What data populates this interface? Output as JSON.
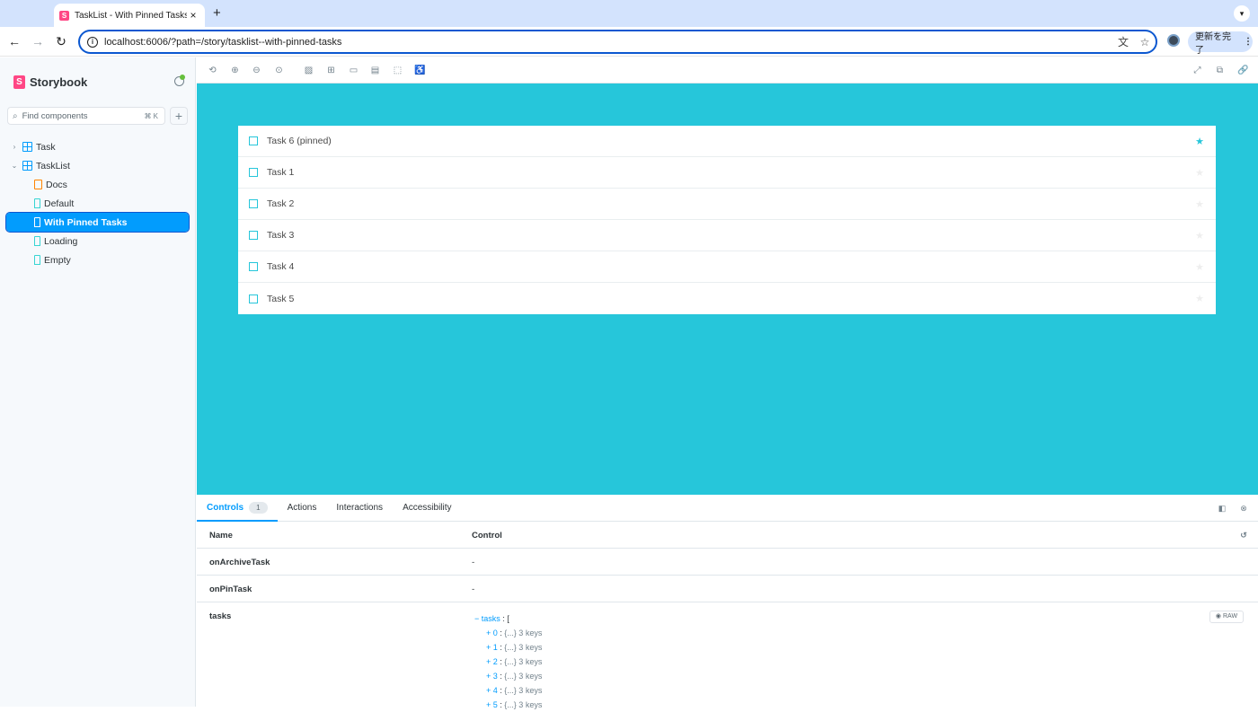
{
  "browser": {
    "tab_title": "TaskList - With Pinned Tasks",
    "tab_close": "×",
    "new_tab": "+",
    "url": "localhost:6006/?path=/story/tasklist--with-pinned-tasks",
    "update_label": "更新を完了"
  },
  "sidebar": {
    "brand": "Storybook",
    "search_placeholder": "Find components",
    "search_shortcut": "⌘ K",
    "tree": [
      {
        "label": "Task",
        "type": "component",
        "expanded": false
      },
      {
        "label": "TaskList",
        "type": "component",
        "expanded": true
      },
      {
        "label": "Docs",
        "type": "docs"
      },
      {
        "label": "Default",
        "type": "story"
      },
      {
        "label": "With Pinned Tasks",
        "type": "story",
        "selected": true
      },
      {
        "label": "Loading",
        "type": "story"
      },
      {
        "label": "Empty",
        "type": "story"
      }
    ]
  },
  "preview": {
    "background": "#26c6da",
    "tasks": [
      {
        "title": "Task 6 (pinned)",
        "pinned": true
      },
      {
        "title": "Task 1",
        "pinned": false
      },
      {
        "title": "Task 2",
        "pinned": false
      },
      {
        "title": "Task 3",
        "pinned": false
      },
      {
        "title": "Task 4",
        "pinned": false
      },
      {
        "title": "Task 5",
        "pinned": false
      }
    ]
  },
  "addons": {
    "tabs": [
      {
        "label": "Controls",
        "badge": "1",
        "active": true
      },
      {
        "label": "Actions"
      },
      {
        "label": "Interactions"
      },
      {
        "label": "Accessibility"
      }
    ],
    "table_head": {
      "name": "Name",
      "control": "Control"
    },
    "rows": [
      {
        "name": "onArchiveTask",
        "control": "-"
      },
      {
        "name": "onPinTask",
        "control": "-"
      }
    ],
    "tasks_arg": {
      "name": "tasks",
      "root_key": "tasks",
      "items": [
        {
          "key": "0",
          "summary": "{...} 3 keys"
        },
        {
          "key": "1",
          "summary": "{...} 3 keys"
        },
        {
          "key": "2",
          "summary": "{...} 3 keys"
        },
        {
          "key": "3",
          "summary": "{...} 3 keys"
        },
        {
          "key": "4",
          "summary": "{...} 3 keys"
        },
        {
          "key": "5",
          "summary": "{...} 3 keys"
        }
      ],
      "raw_label": "RAW"
    }
  },
  "colors": {
    "accent": "#029cfd",
    "brand": "#ff4785",
    "task_accent": "#26c6da"
  }
}
